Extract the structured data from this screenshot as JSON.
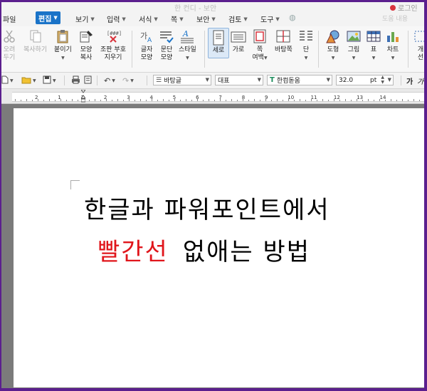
{
  "menubar": {
    "title_ghost": "한 컨디 - 보안",
    "file": "파일",
    "edit": "편집",
    "view": "보기",
    "input": "입력",
    "format": "서식",
    "page": "쪽",
    "security": "보안",
    "review": "검토",
    "tools": "도구",
    "right_ghost": "도움 내용",
    "login_ghost": "로그인"
  },
  "ribbon": {
    "cut": {
      "l1": "오려",
      "l2": "두기"
    },
    "copy": "복사하기",
    "paste": "붙이기",
    "format_copy": {
      "l1": "모양",
      "l2": "복사"
    },
    "clear_format": {
      "l1": "조판 부호",
      "l2": "지우기"
    },
    "char_shape": {
      "l1": "글자",
      "l2": "모양"
    },
    "para_shape": {
      "l1": "문단",
      "l2": "모양"
    },
    "style": "스타일",
    "portrait": "세로",
    "landscape": "가로",
    "margin": {
      "l1": "쪽",
      "l2": "여백"
    },
    "two_page": "바탕쪽",
    "columns": "단",
    "shape": "도형",
    "picture": "그림",
    "table": "표",
    "chart": "차트",
    "object": {
      "l1": "개",
      "l2": "선"
    }
  },
  "fmtbar": {
    "style_combo": "바탕글",
    "lang_combo": "대표",
    "font_combo": "한컴돋움",
    "size_value": "32.0",
    "size_unit": "pt",
    "bold_glyph": "가",
    "italic_glyph": "가"
  },
  "ruler": {
    "numbers": [
      "2",
      "1",
      "1",
      "2",
      "3",
      "4",
      "5",
      "6",
      "7",
      "8",
      "9",
      "10",
      "11",
      "12",
      "13",
      "14"
    ]
  },
  "document": {
    "line1": "한글과 파워포인트에서",
    "line2_red": "빨간선",
    "line2_black": "없애는 방법"
  },
  "colors": {
    "accent": "#1a73c8",
    "frame": "#5b1f8e",
    "red_text": "#e0151b"
  }
}
